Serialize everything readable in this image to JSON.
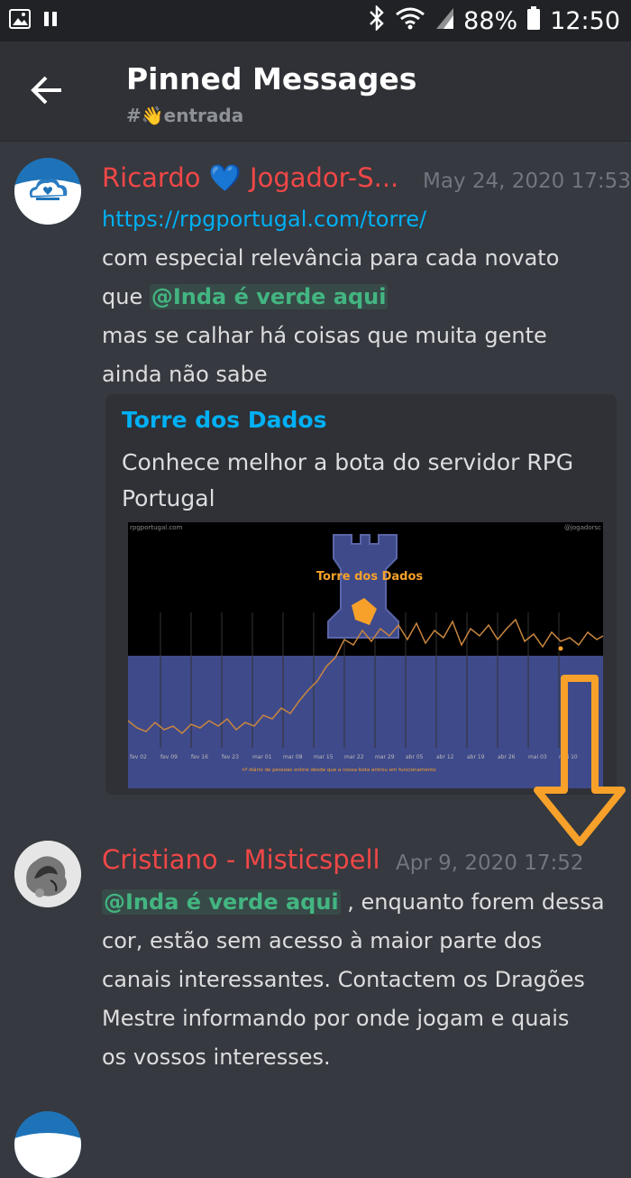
{
  "status_bar": {
    "battery": "88%",
    "time": "12:50"
  },
  "header": {
    "title": "Pinned Messages",
    "channel": "#👋entrada"
  },
  "messages": [
    {
      "author": "Ricardo 💙 Jogador-S...",
      "timestamp": "May 24, 2020 17:53",
      "link": "https://rpgportugal.com/torre/",
      "line1": "com especial relevância para cada novato",
      "line2_prefix": "que ",
      "mention": "@Inda é verde aqui",
      "line3": "mas se calhar há coisas que muita gente",
      "line4": "ainda não sabe",
      "embed": {
        "title": "Torre dos Dados",
        "description": "Conhece melhor a bota do servidor RPG Portugal",
        "image_overlay_title": "Torre dos Dados",
        "image_left_text": "rpgportugal.com",
        "image_right_text": "@jogadorsc",
        "image_caption": "nº diário de pessoas online desde que a nossa bota entrou em funcionamento",
        "image_xlabels": [
          "fev 02",
          "fev 09",
          "fev 16",
          "fev 23",
          "mar 01",
          "mar 08",
          "mar 15",
          "mar 22",
          "mar 29",
          "abr 05",
          "abr 12",
          "abr 19",
          "abr 26",
          "mai 03",
          "mai 10"
        ]
      }
    },
    {
      "author": "Cristiano - Misticspell",
      "timestamp": "Apr 9, 2020 17:52",
      "mention": "@Inda é verde aqui",
      "text_after_mention": " , enquanto forem dessa",
      "line2": "cor, estão sem acesso à maior parte dos",
      "line3": "canais interessantes. Contactem os Dragões",
      "line4": "Mestre informando por onde jogam e quais",
      "line5": "os vossos interesses."
    }
  ],
  "colors": {
    "background": "#36393f",
    "author": "#f04747",
    "link": "#00b0f4",
    "mention": "#43b581",
    "arrow": "#f7a12a"
  }
}
